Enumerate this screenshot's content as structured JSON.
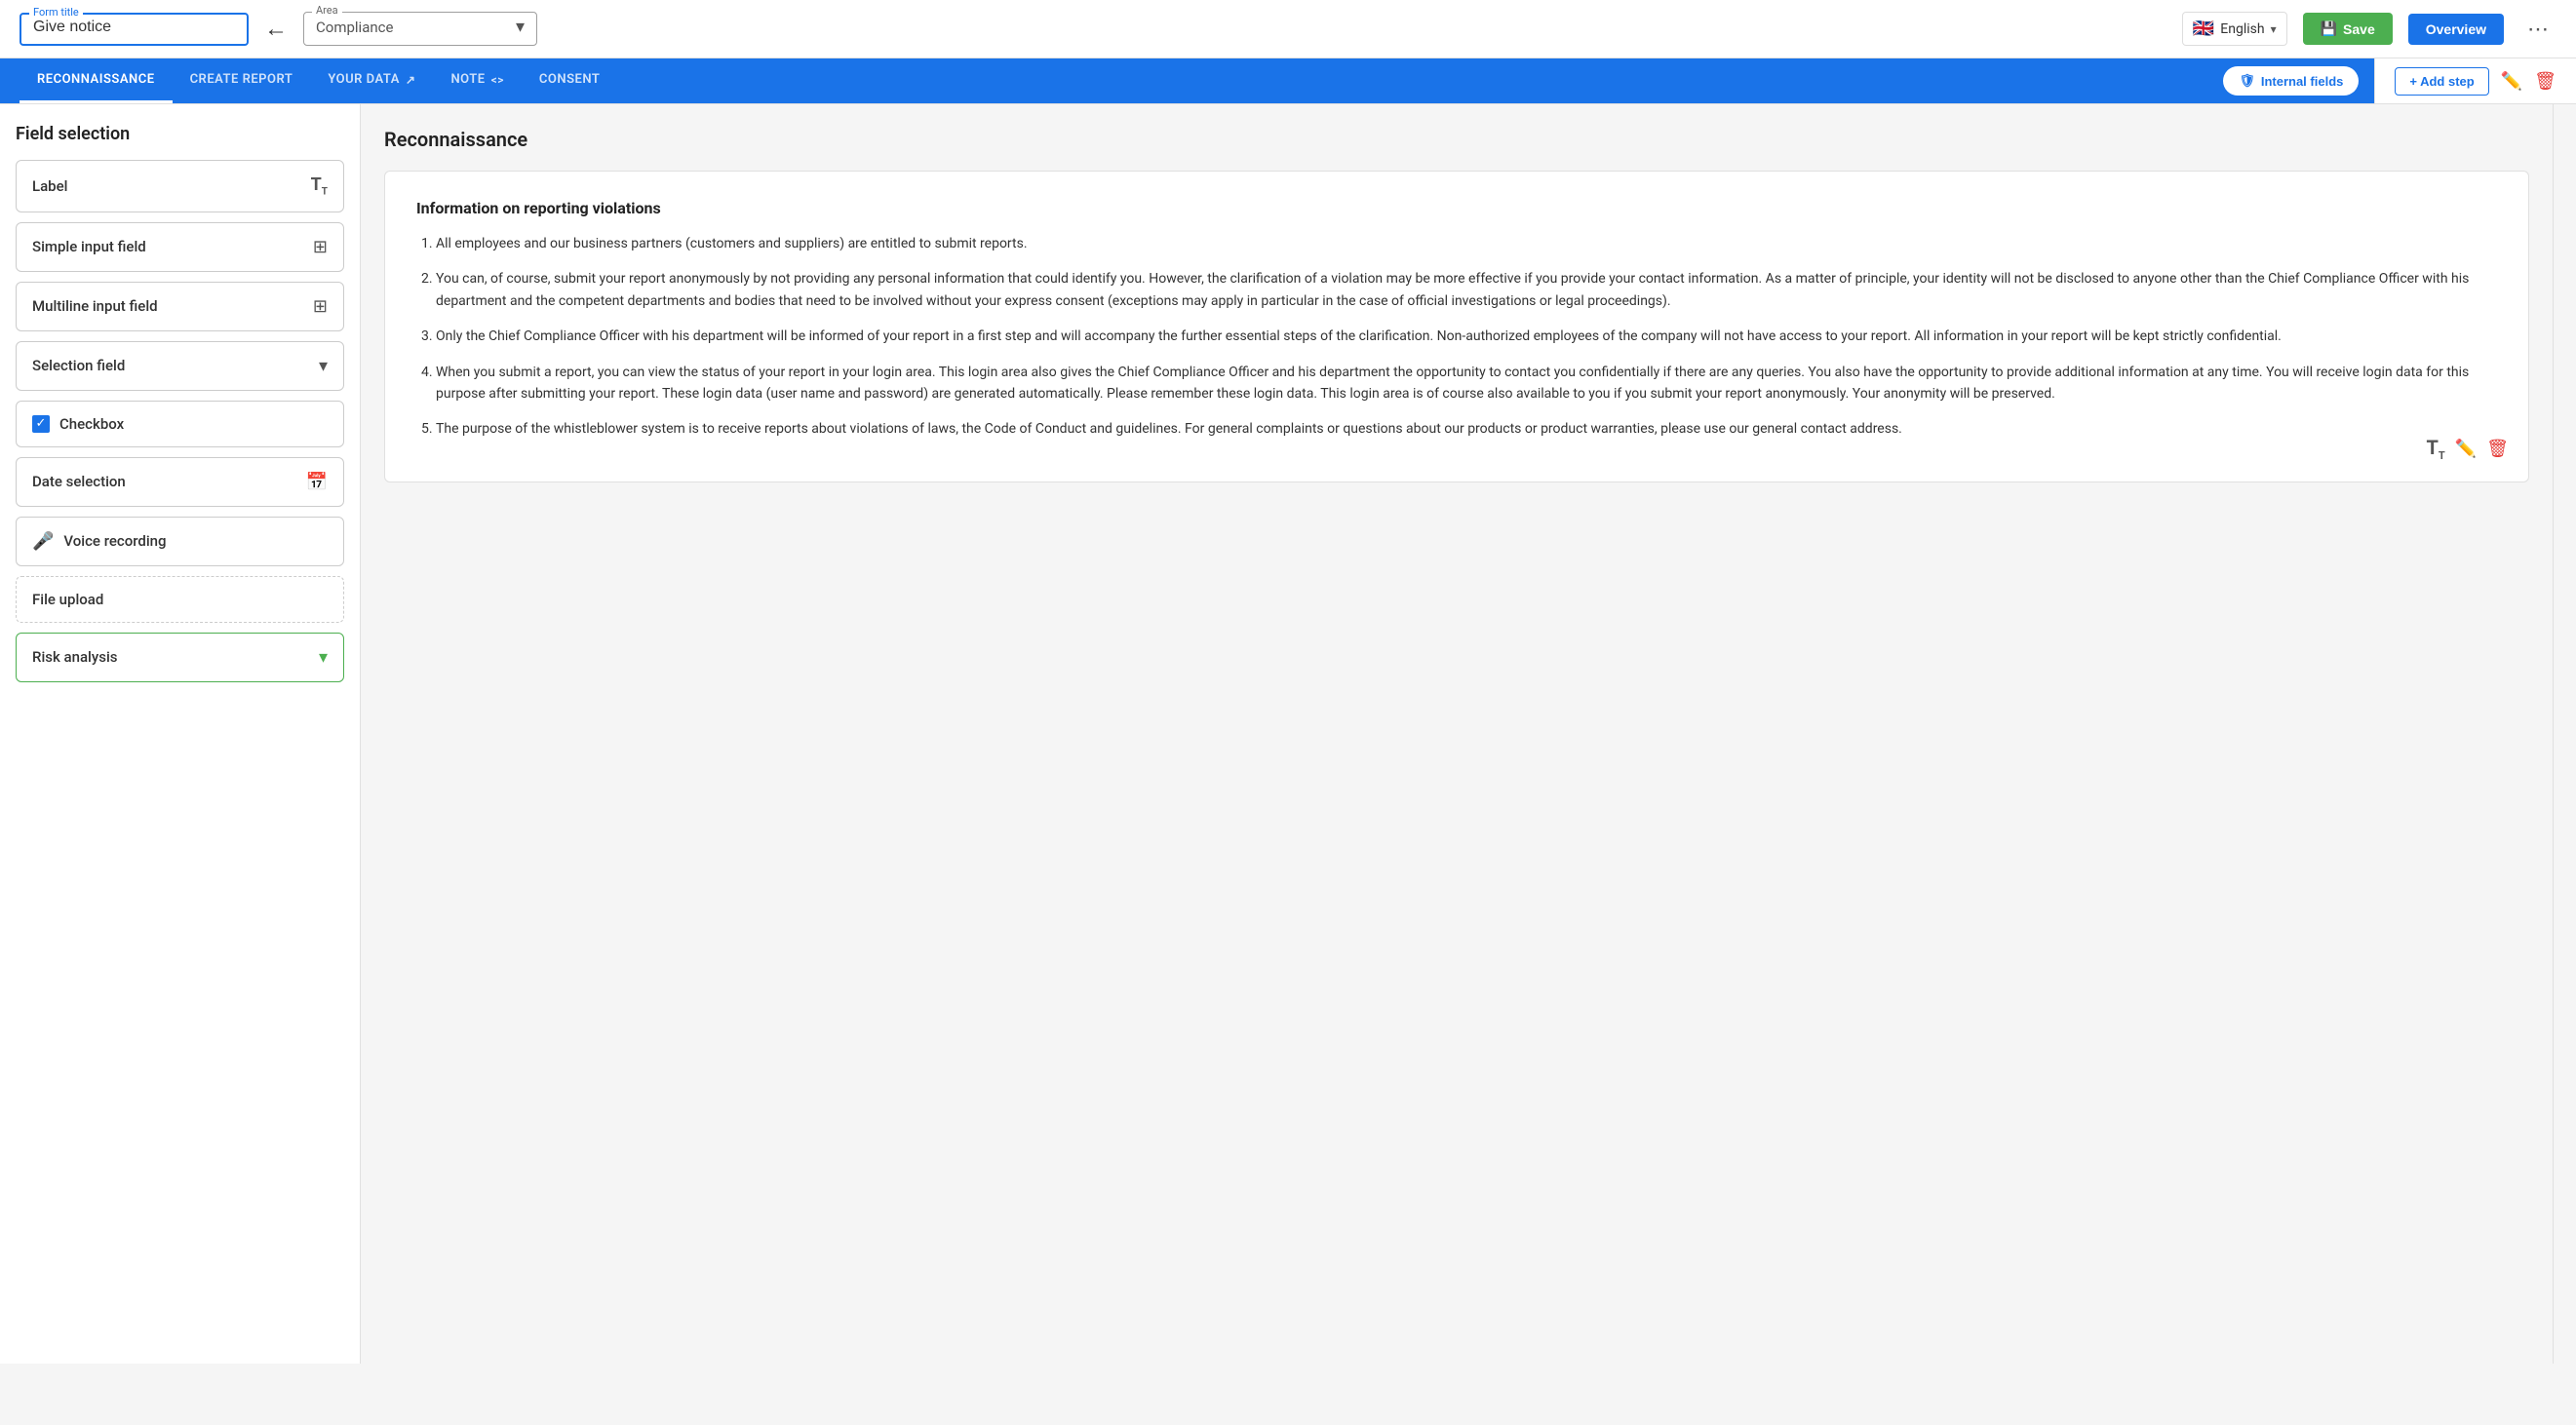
{
  "header": {
    "form_title_label": "Form title",
    "form_title_value": "Give notice",
    "area_label": "Area",
    "area_value": "Compliance",
    "language": "English",
    "save_label": "Save",
    "overview_label": "Overview"
  },
  "nav": {
    "tabs": [
      {
        "id": "reconnaissance",
        "label": "RECONNAISSANCE",
        "active": true
      },
      {
        "id": "create-report",
        "label": "CREATE REPORT",
        "active": false
      },
      {
        "id": "your-data",
        "label": "YOUR DATA",
        "active": false
      },
      {
        "id": "note",
        "label": "NOTE",
        "active": false
      },
      {
        "id": "consent",
        "label": "CONSENT",
        "active": false
      }
    ],
    "internal_fields_label": "Internal fields",
    "add_step_label": "+ Add step"
  },
  "sidebar": {
    "title": "Field selection",
    "fields": [
      {
        "id": "label",
        "label": "Label",
        "icon": "Tᴛ",
        "type": "text"
      },
      {
        "id": "simple-input",
        "label": "Simple input field",
        "icon": "→□",
        "type": "input"
      },
      {
        "id": "multiline-input",
        "label": "Multiline input field",
        "icon": "→□",
        "type": "input"
      },
      {
        "id": "selection-field",
        "label": "Selection field",
        "icon": "▾",
        "type": "select"
      },
      {
        "id": "checkbox",
        "label": "Checkbox",
        "icon": "✓",
        "type": "checkbox"
      },
      {
        "id": "date-selection",
        "label": "Date selection",
        "icon": "📅",
        "type": "date"
      },
      {
        "id": "voice-recording",
        "label": "Voice recording",
        "icon": "🎤",
        "type": "audio"
      },
      {
        "id": "file-upload",
        "label": "File upload",
        "icon": "",
        "type": "file",
        "dashed": true
      },
      {
        "id": "risk-analysis",
        "label": "Risk analysis",
        "icon": "▾",
        "type": "risk",
        "accent": true
      }
    ]
  },
  "main": {
    "title": "Reconnaissance",
    "content_heading": "Information on reporting violations",
    "paragraphs": [
      "All employees and our business partners (customers and suppliers) are entitled to submit reports.",
      "You can, of course, submit your report anonymously by not providing any personal information that could identify you. However, the clarification of a violation may be more effective if you provide your contact information. As a matter of principle, your identity will not be disclosed to anyone other than the Chief Compliance Officer with his department and the competent departments and bodies that need to be involved without your express consent (exceptions may apply in particular in the case of official investigations or legal proceedings).",
      "Only the Chief Compliance Officer with his department will be informed of your report in a first step and will accompany the further essential steps of the clarification. Non-authorized employees of the company will not have access to your report. All information in your report will be kept strictly confidential.",
      "When you submit a report, you can view the status of your report in your login area. This login area also gives the Chief Compliance Officer and his department the opportunity to contact you confidentially if there are any queries. You also have the opportunity to provide additional information at any time. You will receive login data for this purpose after submitting your report. These login data (user name and password) are generated automatically. Please remember these login data. This login area is of course also available to you if you submit your report anonymously. Your anonymity will be preserved.",
      "The purpose of the whistleblower system is to receive reports about violations of laws, the Code of Conduct and guidelines. For general complaints or questions about our products or product warranties, please use our general contact address."
    ]
  },
  "colors": {
    "primary": "#1a73e8",
    "success": "#4caf50",
    "danger": "#e53935",
    "tab_bg": "#1a73e8"
  }
}
